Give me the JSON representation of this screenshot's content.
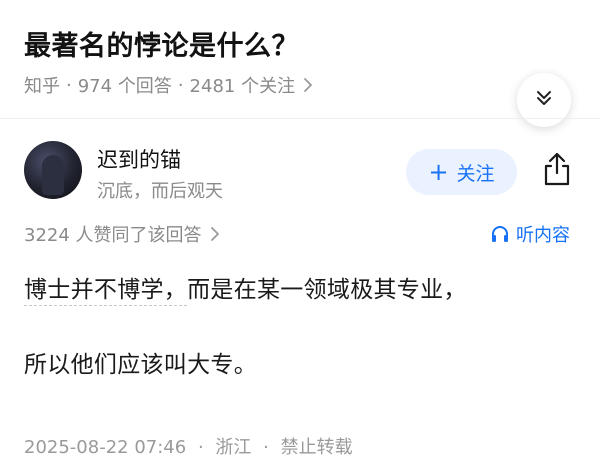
{
  "question": {
    "title": "最著名的悖论是什么？",
    "source": "知乎",
    "answers_count": "974 个回答",
    "followers_count": "2481 个关注"
  },
  "author": {
    "name": "迟到的锚",
    "bio": "沉底，而后观天",
    "follow_label": "关注"
  },
  "answer": {
    "upvote_info": "3224 人赞同了该回答",
    "listen_label": "听内容",
    "paragraph_1_part_a": "博士并不博学，",
    "paragraph_1_part_b": "而是在某一领域极其专业，",
    "paragraph_2": "所以他们应该叫大专。",
    "date": "2025-08-22 07:46",
    "location": "浙江",
    "copyright": "禁止转载"
  },
  "icons": {
    "collapse": "double-chevron-down-icon",
    "share": "share-icon",
    "listen": "headphones-icon",
    "chevron": "chevron-right-icon"
  },
  "colors": {
    "accent": "#1772f6",
    "follow_bg": "#ebf2ff",
    "muted_text": "#8a8a8a"
  }
}
